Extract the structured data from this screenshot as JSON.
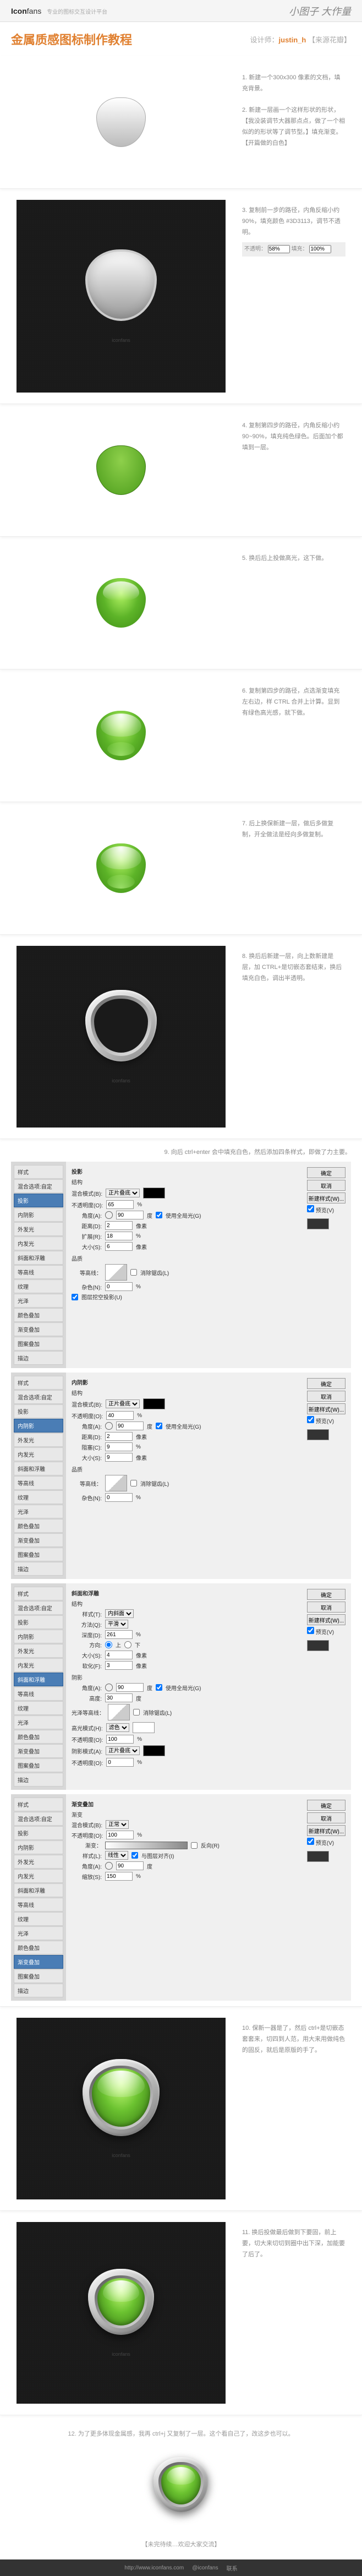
{
  "header": {
    "logo_prefix": "Icon",
    "logo_suffix": "fans",
    "logo_tagline": "专业的图标交互设计平台",
    "slogan": "小图子 大作量"
  },
  "title": {
    "main": "金属质感图标制作教程",
    "designer_label": "设计师：",
    "designer_name": "justin_h",
    "designer_note": "【来源花瓣】"
  },
  "steps": {
    "s1": "1. 新建一个300x300 像素的文档，填充背景。",
    "s2": "2. 新建一层画一个这样形状的形状，【我没装调节大器那点点，做了一个相似的的形状等了调节型。】填充渐变。\n【开篇做的白色】",
    "s3": "3. 复制前一步的路径，内角反缩小约 90%，填充颜色 #3D3113，调节不透明。",
    "s3_opacity": "不透明：",
    "s3_input1": "58%",
    "s3_input2": "100%",
    "s3_fill": "填充：",
    "s4": "4. 复制第四步的路径，内角反缩小约 90~90%，填充纯色绿色。后面加个都填到一层。",
    "s5": "5. 换后后上投做高光，这下做。",
    "s6": "6. 复制第四步的路径，点选渐变填充左右边，样 CTRL 合并上计算。显到有绿色高光感，就下做。",
    "s7": "7. 后上换保新建一层，做后多做复制，开全做法是经向多做复制。",
    "s8": "8. 换后后新建一层，向上数新建是层，加 CTRL+是切嵌态套结束，换后填充白色，调出半透明。",
    "s9": "9. 向后 ctrl+enter 会中填充白色，然后添加四条样式，即做了力主要。",
    "s10": "10. 保新一器是了，然后 ctrl+是切嵌态套套来，切四到人范，用大来用做纯色的固反，就后是原版的手了。",
    "s11": "11. 换后投做最后做到下要固，前上要，切大来切切到圈中出下深，加能要了后了。",
    "s12": "12. 为了更多体现金属感，我再 ctrl+j 又复制了一层。这个看自己了，改这步也可以。"
  },
  "ps": {
    "side": [
      "样式",
      "混合选项:自定",
      "投影",
      "内阴影",
      "外发光",
      "内发光",
      "斜面和浮雕",
      "等高线",
      "纹理",
      "光泽",
      "颜色叠加",
      "渐变叠加",
      "图案叠加",
      "描边"
    ],
    "panel1": {
      "title": "投影",
      "subtitle": "结构",
      "blend_label": "混合模式(B):",
      "blend": "正片叠底",
      "opacity_label": "不透明度(O):",
      "opacity": "65",
      "pct": "%",
      "angle_label": "角度(A):",
      "angle": "90",
      "deg": "度",
      "global": "使用全局光(G)",
      "dist_label": "距离(D):",
      "dist": "2",
      "px": "像素",
      "spread_label": "扩展(R):",
      "spread": "18",
      "size_label": "大小(S):",
      "size": "6",
      "quality": "品质",
      "contour": "等高线：",
      "anti": "消除锯齿(L)",
      "noise_label": "杂色(N):",
      "noise": "0",
      "knockout": "图层挖空投影(U)",
      "btns": [
        "确定",
        "取消",
        "新建样式(W)...",
        "预览(V)"
      ]
    },
    "panel2": {
      "title": "内阴影",
      "opacity": "40",
      "angle": "90",
      "dist": "2",
      "choke_label": "阻塞(C):",
      "choke": "9",
      "size": "9",
      "noise": "0"
    },
    "panel3": {
      "title": "斜面和浮雕",
      "style_label": "样式(T):",
      "style": "内斜面",
      "tech_label": "方法(Q):",
      "tech": "平滑",
      "depth_label": "深度(D):",
      "depth": "261",
      "dir_label": "方向:",
      "up": "上",
      "down": "下",
      "size": "4",
      "soften_label": "软化(F):",
      "soften": "3",
      "shade": "阴影",
      "angle": "90",
      "alt_label": "高度:",
      "alt": "30",
      "gloss": "光泽等高线：",
      "hl_label": "高光模式(H):",
      "hl": "滤色",
      "hl_op": "100",
      "sh_label": "阴影模式(A):",
      "sh": "正片叠底",
      "sh_op": "0"
    },
    "panel4": {
      "title": "渐变叠加",
      "subtitle": "渐变",
      "blend": "正常",
      "opacity": "100",
      "grad_label": "渐变：",
      "reverse": "反向(R)",
      "style_label": "样式(L):",
      "style": "线性",
      "align": "与图层对齐(I)",
      "angle": "90",
      "scale_label": "缩放(S):",
      "scale": "150"
    }
  },
  "end": "【未完待续…欢迎大家交流】",
  "footer": {
    "url": "http://www.iconfans.com",
    "wb": "@iconfans",
    "contact": "联系"
  }
}
